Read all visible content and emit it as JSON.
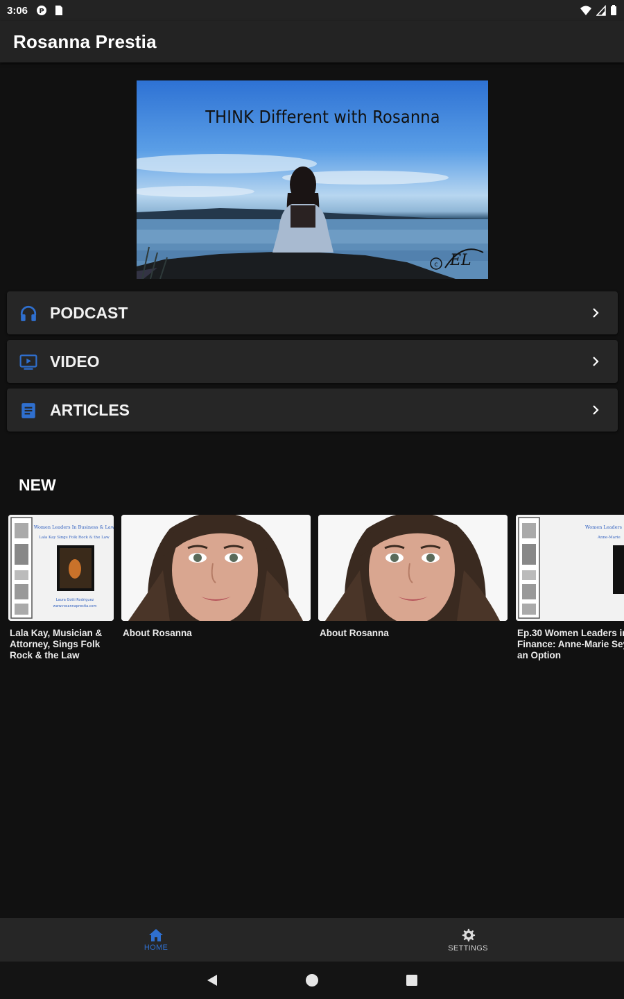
{
  "status_bar": {
    "time": "3:06"
  },
  "app_bar": {
    "title": "Rosanna Prestia"
  },
  "hero": {
    "title": "THINK Different with Rosanna"
  },
  "menu": [
    {
      "label": "PODCAST",
      "icon": "headphones-icon"
    },
    {
      "label": "VIDEO",
      "icon": "video-icon"
    },
    {
      "label": "ARTICLES",
      "icon": "article-icon"
    }
  ],
  "new_section": {
    "title": "NEW",
    "items": [
      {
        "title": "Lala Kay, Musician &\nAttorney, Sings Folk\nRock & the Law"
      },
      {
        "title": "About Rosanna"
      },
      {
        "title": "About Rosanna"
      },
      {
        "title": "Ep.30 Women Leaders in\nFinance: Anne-Marie Sey\nan Option"
      }
    ]
  },
  "bottom_nav": {
    "home_label": "HOME",
    "settings_label": "SETTINGS"
  },
  "colors": {
    "accent": "#2f6fce",
    "background": "#111111",
    "surface": "#262626"
  }
}
